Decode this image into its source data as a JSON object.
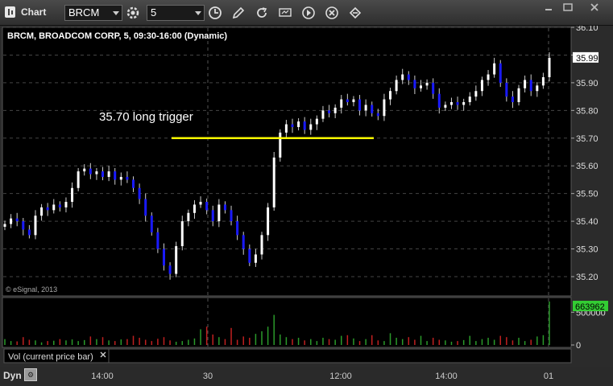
{
  "window": {
    "title": "Chart",
    "symbol": "BRCM",
    "interval": "5"
  },
  "chart_data": {
    "type": "candlestick",
    "title": "BRCM, BROADCOM CORP, 5, 09:30-16:00 (Dynamic)",
    "copyright": "© eSignal, 2013",
    "annotation": "35.70 long trigger",
    "trigger_price": 35.7,
    "current_price": "35.99",
    "ylim": [
      35.15,
      36.12
    ],
    "yticks": [
      "36.10",
      "36.00",
      "35.90",
      "35.80",
      "35.70",
      "35.60",
      "35.50",
      "35.40",
      "35.30",
      "35.20"
    ],
    "ytick_values": [
      36.1,
      36.0,
      35.9,
      35.8,
      35.7,
      35.6,
      35.5,
      35.4,
      35.3,
      35.2
    ],
    "colors": {
      "up": "#ffffff",
      "down": "#1a1aff",
      "trigger": "#ffff00",
      "price_label_bg": "#ffffff",
      "vol_label_bg": "#33cc33",
      "vol_up": "#2a9a2a",
      "vol_down": "#c02020"
    },
    "closes": [
      35.39,
      35.41,
      35.4,
      35.37,
      35.35,
      35.42,
      35.45,
      35.44,
      35.46,
      35.45,
      35.47,
      35.52,
      35.58,
      35.59,
      35.57,
      35.58,
      35.56,
      35.58,
      35.55,
      35.56,
      35.55,
      35.52,
      35.48,
      35.42,
      35.36,
      35.3,
      35.24,
      35.21,
      35.31,
      35.4,
      35.43,
      35.46,
      35.47,
      35.44,
      35.4,
      35.46,
      35.44,
      35.4,
      35.35,
      35.3,
      35.25,
      35.28,
      35.35,
      35.45,
      35.63,
      35.72,
      35.75,
      35.74,
      35.76,
      35.73,
      35.75,
      35.77,
      35.8,
      35.79,
      35.81,
      35.84,
      35.83,
      35.84,
      35.8,
      35.82,
      35.79,
      35.78,
      35.84,
      35.87,
      35.91,
      35.93,
      35.91,
      35.88,
      35.89,
      35.9,
      35.86,
      35.81,
      35.82,
      35.83,
      35.82,
      35.83,
      35.85,
      35.87,
      35.91,
      35.93,
      35.97,
      35.9,
      35.85,
      35.83,
      35.88,
      35.91,
      35.87,
      35.89,
      35.92,
      35.99
    ],
    "volume": {
      "label": "Vol (current price bar)",
      "current": "663962",
      "yticks": [
        "500000",
        "0"
      ],
      "ytick_values": [
        500000,
        0
      ],
      "ylim": [
        0,
        700000
      ],
      "values": [
        90000,
        60000,
        55000,
        120000,
        80000,
        70000,
        40000,
        60000,
        65000,
        90000,
        70000,
        85000,
        60000,
        75000,
        130000,
        90000,
        120000,
        70000,
        60000,
        85000,
        90000,
        140000,
        110000,
        80000,
        60000,
        95000,
        120000,
        70000,
        50000,
        60000,
        80000,
        100000,
        240000,
        280000,
        160000,
        120000,
        90000,
        260000,
        80000,
        130000,
        110000,
        170000,
        210000,
        280000,
        460000,
        160000,
        120000,
        90000,
        110000,
        70000,
        90000,
        60000,
        110000,
        90000,
        80000,
        140000,
        150000,
        100000,
        60000,
        90000,
        150000,
        70000,
        60000,
        180000,
        110000,
        90000,
        120000,
        80000,
        140000,
        60000,
        110000,
        80000,
        70000,
        50000,
        60000,
        75000,
        140000,
        60000,
        90000,
        110000,
        80000,
        140000,
        120000,
        70000,
        110000,
        60000,
        80000,
        130000,
        150000,
        663962
      ]
    }
  },
  "axis": {
    "x_labels": [
      "14:00",
      "30",
      "12:00",
      "14:00",
      "01"
    ]
  },
  "status": {
    "mode": "Dyn"
  }
}
